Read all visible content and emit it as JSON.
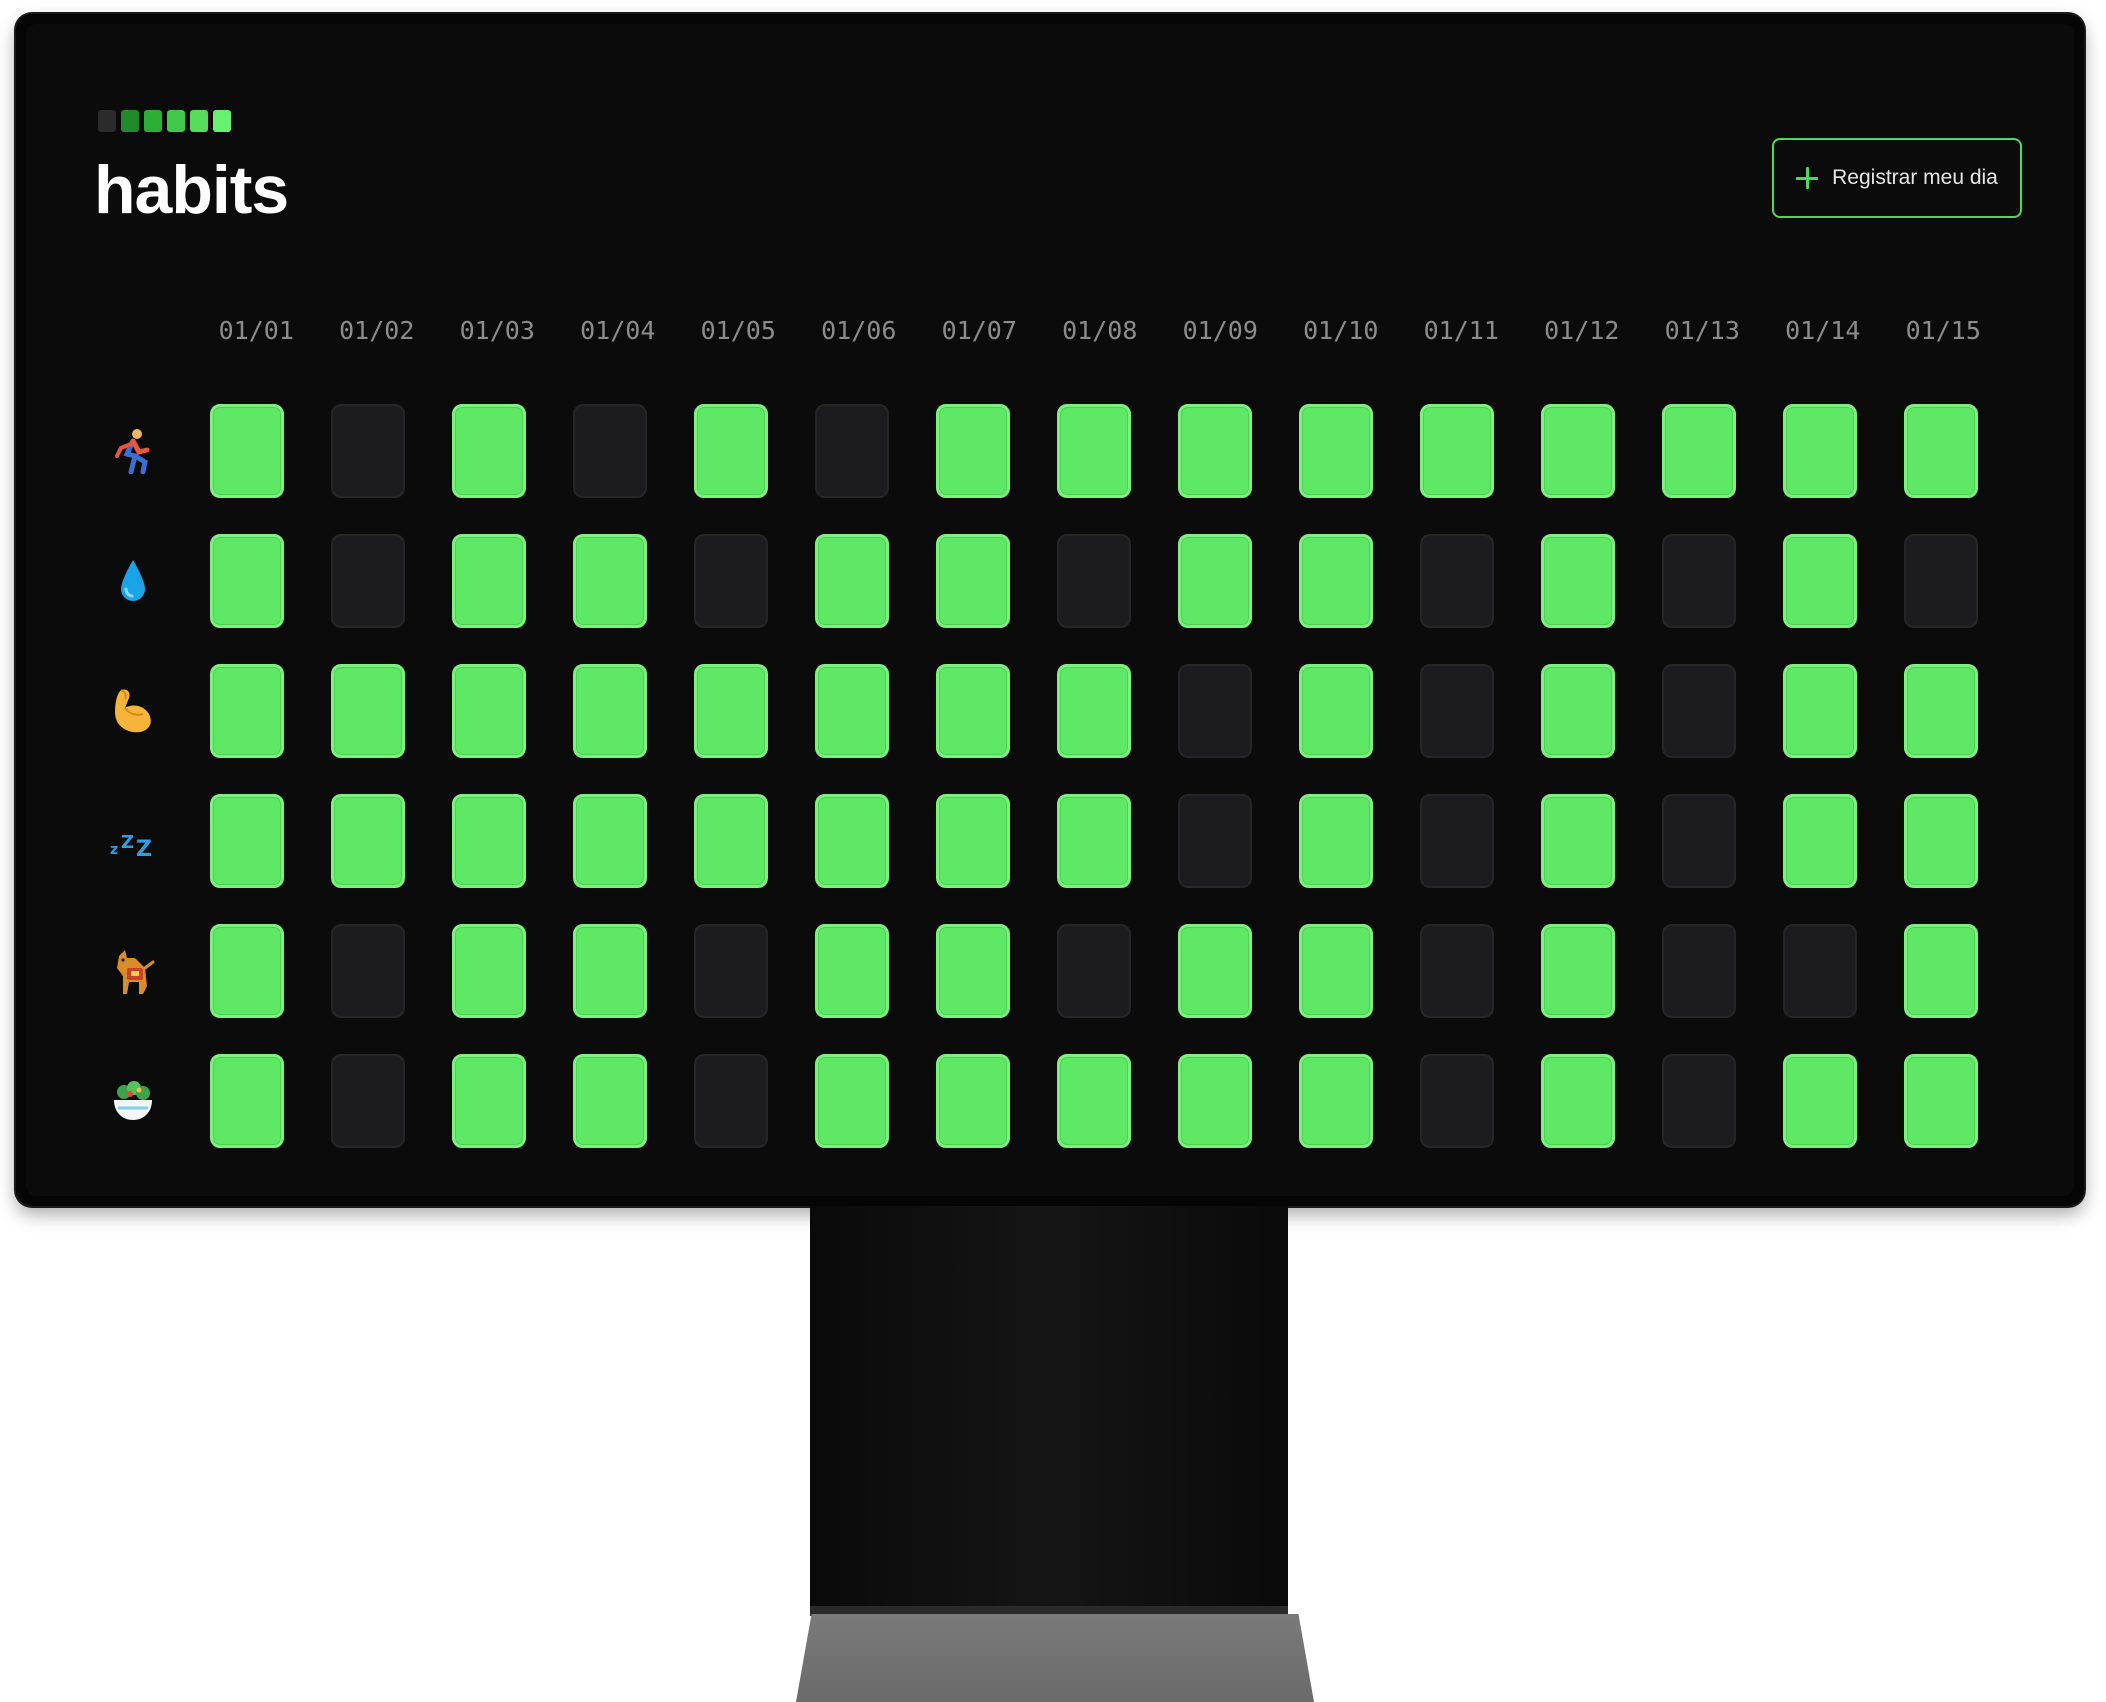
{
  "app": {
    "title": "habits",
    "logo_colors": [
      "#2b2b2b",
      "#1f8b2a",
      "#2fae37",
      "#40c948",
      "#56dd5c",
      "#6af070"
    ]
  },
  "header": {
    "register_button_label": "Registrar meu dia",
    "register_button_icon": "plus-icon"
  },
  "colors": {
    "done": "#5fe865",
    "not_done": "#1c1c1e",
    "accent": "#4ed85a",
    "background": "#0b0b0b"
  },
  "dates": [
    "01/01",
    "01/02",
    "01/03",
    "01/04",
    "01/05",
    "01/06",
    "01/07",
    "01/08",
    "01/09",
    "01/10",
    "01/11",
    "01/12",
    "01/13",
    "01/14",
    "01/15"
  ],
  "habits": [
    {
      "icon": "running-person-icon",
      "done": [
        1,
        0,
        1,
        0,
        1,
        0,
        1,
        1,
        1,
        1,
        1,
        1,
        1,
        1,
        1
      ]
    },
    {
      "icon": "water-drop-icon",
      "done": [
        1,
        0,
        1,
        1,
        0,
        1,
        1,
        0,
        1,
        1,
        0,
        1,
        0,
        1,
        0
      ]
    },
    {
      "icon": "flexed-biceps-icon",
      "done": [
        1,
        1,
        1,
        1,
        1,
        1,
        1,
        1,
        0,
        1,
        0,
        1,
        0,
        1,
        1
      ]
    },
    {
      "icon": "sleep-zzz-icon",
      "done": [
        1,
        1,
        1,
        1,
        1,
        1,
        1,
        1,
        0,
        1,
        0,
        1,
        0,
        1,
        1
      ]
    },
    {
      "icon": "service-dog-icon",
      "done": [
        1,
        0,
        1,
        1,
        0,
        1,
        1,
        0,
        1,
        1,
        0,
        1,
        0,
        0,
        1
      ]
    },
    {
      "icon": "salad-bowl-icon",
      "done": [
        1,
        0,
        1,
        1,
        0,
        1,
        1,
        1,
        1,
        1,
        0,
        1,
        0,
        1,
        1
      ]
    }
  ]
}
